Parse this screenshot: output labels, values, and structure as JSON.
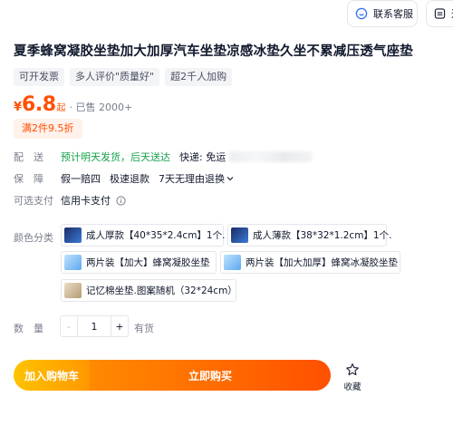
{
  "top_buttons": {
    "customer_service": "联系客服",
    "more": "进"
  },
  "product": {
    "title": "夏季蜂窝凝胶坐垫加大加厚汽车坐垫凉感冰垫久坐不累减压透气座垫",
    "tags": [
      "可开发票",
      "多人评价\"质量好\"",
      "超2千人加购"
    ]
  },
  "price": {
    "currency": "¥",
    "amount": "6.8",
    "unit": "起",
    "sold": "· 已售 2000+"
  },
  "promo": "满2件9.5折",
  "delivery": {
    "label": "配　送",
    "eta": "预计明天发货，后天送达",
    "express": "快递: 免运"
  },
  "guarantee": {
    "label": "保　障",
    "items": [
      "假一赔四",
      "极速退款",
      "7天无理由退换"
    ]
  },
  "installment": {
    "label": "可选支付",
    "value": "信用卡支付"
  },
  "color": {
    "label": "颜色分类",
    "options": [
      "成人厚款【40*35*2.4cm】1个.",
      "成人薄款【38*32*1.2cm】1个.",
      "两片装【加大】蜂窝凝胶坐垫",
      "两片装【加大加厚】蜂窝冰凝胶坐垫",
      "记忆棉坐垫.图案随机（32*24cm）"
    ]
  },
  "quantity": {
    "label": "数　量",
    "minus": "-",
    "value": "1",
    "plus": "+",
    "stock": "有货"
  },
  "actions": {
    "add_to_cart": "加入购物车",
    "buy_now": "立即购买",
    "favorite": "收藏"
  },
  "icons": {
    "customer_service": "headset-icon",
    "more": "more-icon",
    "info": "info-icon",
    "chevron": "chevron-down-icon",
    "favorite": "star-icon"
  },
  "colors": {
    "accent": "#ff5000",
    "cart_gradient": [
      "#ffc200",
      "#ff9800"
    ],
    "buy_gradient": [
      "#ff8a00",
      "#ff5000"
    ],
    "delivery_green": "#15a14a"
  }
}
